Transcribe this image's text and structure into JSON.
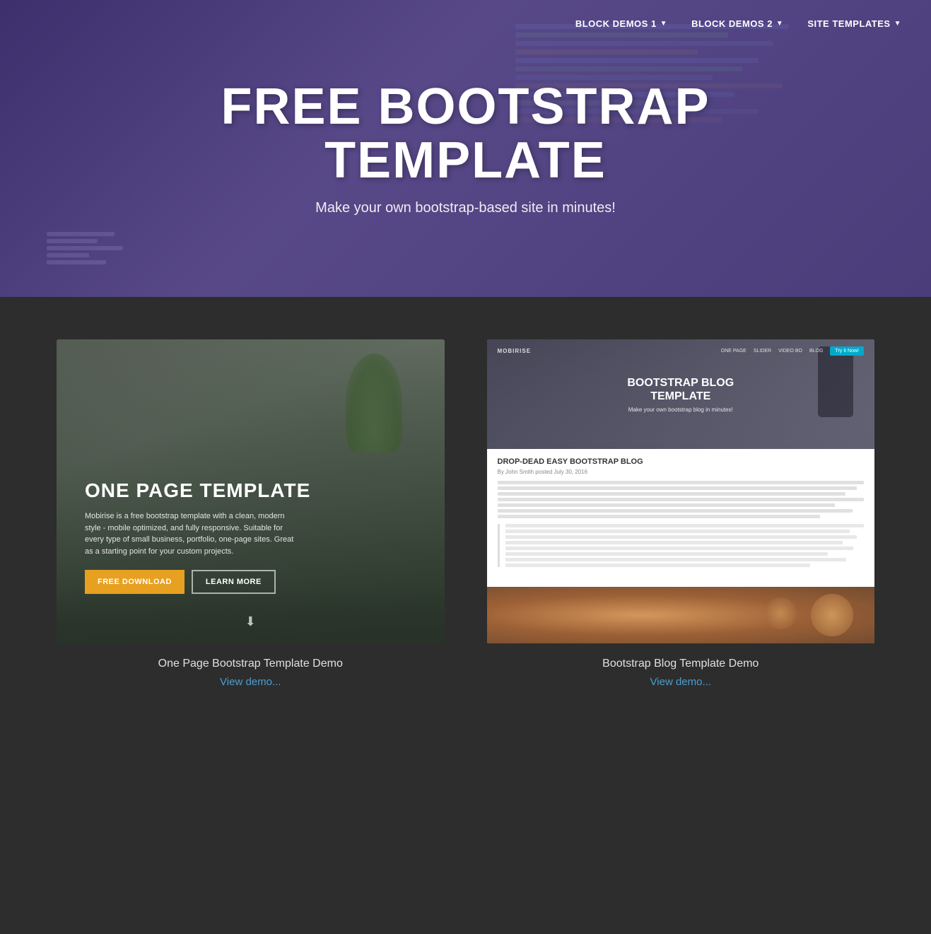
{
  "nav": {
    "items": [
      {
        "label": "BLOCK DEMOS 1",
        "has_dropdown": true
      },
      {
        "label": "BLOCK DEMOS 2",
        "has_dropdown": true
      },
      {
        "label": "SITE TEMPLATES",
        "has_dropdown": true
      }
    ]
  },
  "hero": {
    "title": "FREE BOOTSTRAP\nTEMPLATE",
    "title_line1": "FREE BOOTSTRAP",
    "title_line2": "TEMPLATE",
    "subtitle": "Make your own bootstrap-based site in minutes!"
  },
  "cards": [
    {
      "id": "card-one-page",
      "image_alt": "One Page Bootstrap Template Preview",
      "template_title": "ONE PAGE TEMPLATE",
      "template_desc": "Mobirise is a free bootstrap template with a clean, modern style - mobile optimized, and fully responsive. Suitable for every type of small business, portfolio, one-page sites. Great as a starting point for your custom projects.",
      "btn_primary": "FREE DOWNLOAD",
      "btn_secondary": "LEARN MORE",
      "label": "One Page Bootstrap Template Demo",
      "link": "View demo..."
    },
    {
      "id": "card-blog",
      "image_alt": "Bootstrap Blog Template Preview",
      "nav_brand": "MOBIRISE",
      "nav_links": [
        "ONE PAGE",
        "SLIDER",
        "VIDEO BO",
        "BLOG"
      ],
      "nav_cta": "Try It Now!",
      "template_title": "BOOTSTRAP BLOG\nTEMPLATE",
      "template_subtitle": "Make your own bootstrap blog in minutes!",
      "article_title": "DROP-DEAD EASY BOOTSTRAP BLOG",
      "byline": "By John Smith posted July 30, 2016",
      "label": "Bootstrap Blog Template Demo",
      "link": "View demo..."
    }
  ],
  "colors": {
    "bg_dark": "#2d2d2d",
    "hero_purple": "#4a3d7a",
    "accent_blue": "#4a9fd4",
    "accent_orange": "#e8a020",
    "nav_cta": "#00aacc",
    "text_light": "#e0e0e0",
    "text_muted": "#888"
  }
}
